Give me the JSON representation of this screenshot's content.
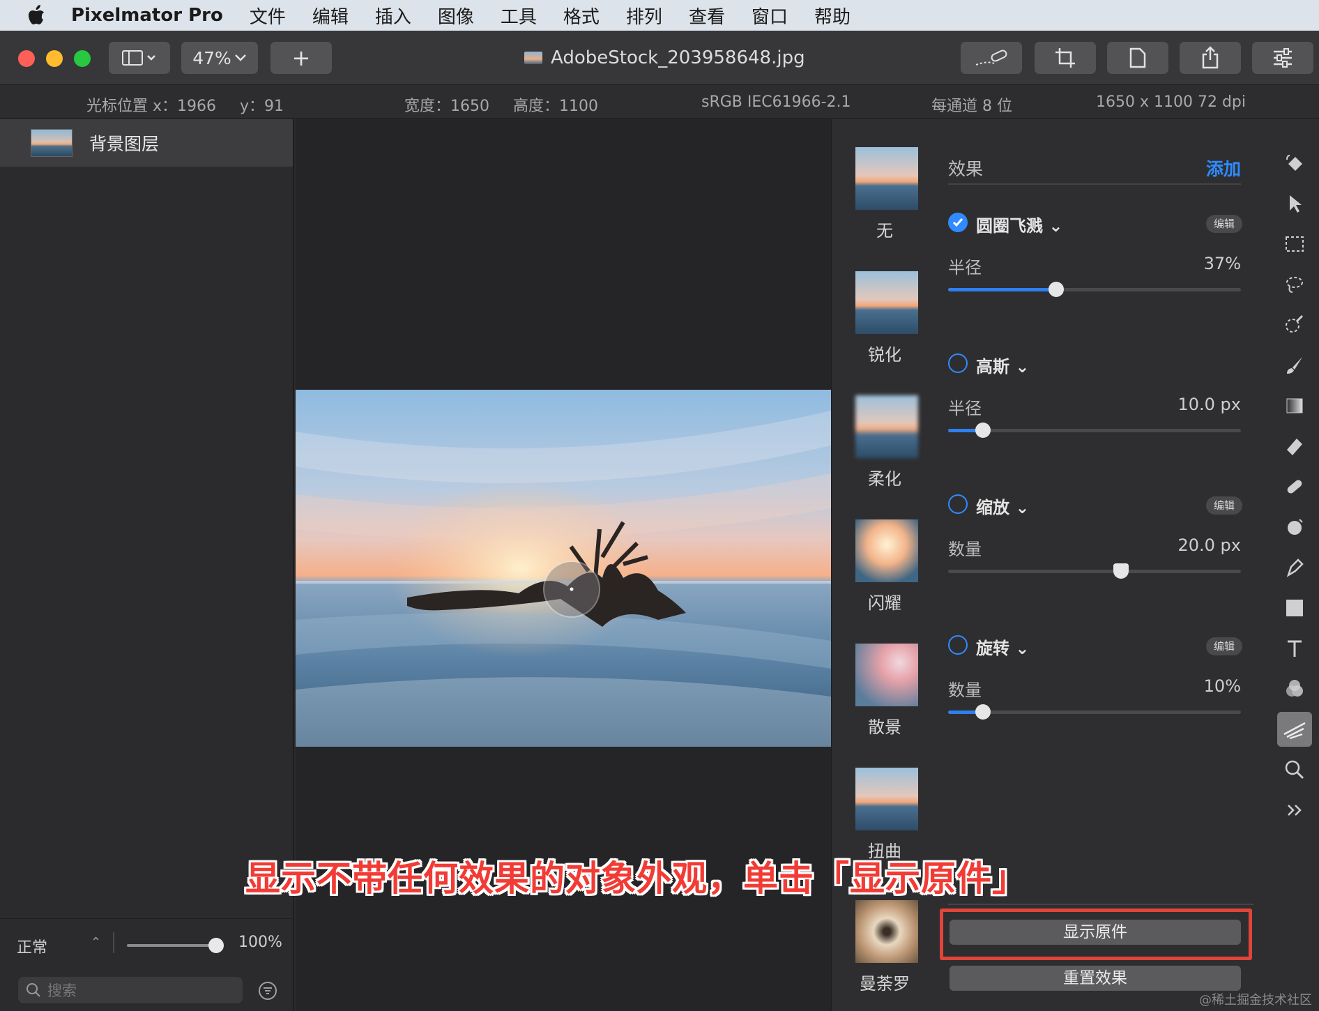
{
  "menubar": {
    "app_name": "Pixelmator Pro",
    "items": [
      "文件",
      "编辑",
      "插入",
      "图像",
      "工具",
      "格式",
      "排列",
      "查看",
      "窗口",
      "帮助"
    ]
  },
  "toolbar": {
    "zoom": "47%",
    "add_label": "+",
    "document_title": "AdobeStock_203958648.jpg"
  },
  "infobar": {
    "cursor_x": "光标位置 x：1966",
    "cursor_y": "y：91",
    "width": "宽度：1650",
    "height": "高度：1100",
    "color_profile": "sRGB IEC61966-2.1",
    "bit_depth": "每通道 8 位",
    "resolution": "1650 x 1100 72 dpi"
  },
  "layers": {
    "items": [
      {
        "name": "背景图层"
      }
    ],
    "blend_mode": "正常",
    "opacity_value": 1.0,
    "opacity_label": "100%",
    "search_placeholder": "搜索"
  },
  "effect_presets": [
    "无",
    "锐化",
    "柔化",
    "闪耀",
    "散景",
    "扭曲",
    "曼荼罗"
  ],
  "effects_panel": {
    "header": "效果",
    "add_label": "添加",
    "edit_label": "编辑",
    "effects": [
      {
        "name": "圆圈飞溅",
        "enabled": true,
        "param": "半径",
        "value_label": "37%",
        "value": 0.37,
        "has_edit": true
      },
      {
        "name": "高斯",
        "enabled": false,
        "param": "半径",
        "value_label": "10.0 px",
        "value": 0.12,
        "has_edit": false
      },
      {
        "name": "缩放",
        "enabled": false,
        "param": "数量",
        "value_label": "20.0 px",
        "value": 0.59,
        "has_edit": true
      },
      {
        "name": "旋转",
        "enabled": false,
        "param": "数量",
        "value_label": "10%",
        "value": 0.12,
        "has_edit": true
      }
    ],
    "show_original_label": "显示原件",
    "reset_label": "重置效果"
  },
  "tools": [
    "paint-bucket-icon",
    "arrow-icon",
    "rect-select-icon",
    "lasso-icon",
    "quick-select-icon",
    "brush-icon",
    "gradient-icon",
    "eraser-icon",
    "repair-icon",
    "clone-icon",
    "pen-icon",
    "shape-icon",
    "text-icon",
    "color-adjust-icon",
    "effects-icon",
    "zoom-icon",
    "more-icon"
  ],
  "caption": "显示不带任何效果的对象外观，单击「显示原件」",
  "watermark": "@稀土掘金技术社区",
  "colors": {
    "accent": "#2f8bff",
    "highlight": "#e2443a",
    "caption": "#f23b35"
  }
}
